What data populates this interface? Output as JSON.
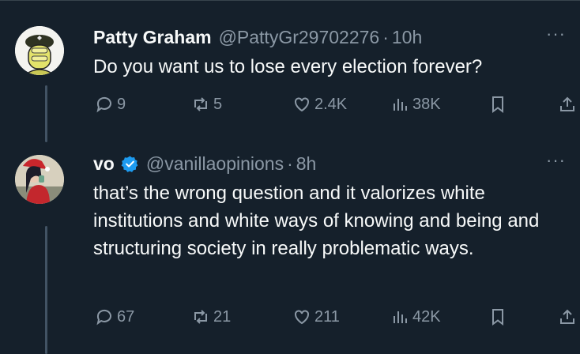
{
  "tweets": [
    {
      "name": "Patty Graham",
      "handle": "@PattyGr29702276",
      "separator": "·",
      "time": "10h",
      "more": "···",
      "text": "Do you want us to lose every election forever?",
      "verified": false,
      "stats": {
        "replies": "9",
        "retweets": "5",
        "likes": "2.4K",
        "views": "38K"
      }
    },
    {
      "name": "vo",
      "handle": "@vanillaopinions",
      "separator": "·",
      "time": "8h",
      "more": "···",
      "text": "that’s the wrong question and it valorizes white institutions and white ways of knowing and being and structuring society in really problematic ways.",
      "verified": true,
      "stats": {
        "replies": "67",
        "retweets": "21",
        "likes": "211",
        "views": "42K"
      }
    }
  ],
  "colors": {
    "background": "#15202b",
    "text": "#f7f9f9",
    "muted": "#8b98a5",
    "verified": "#1d9bf0",
    "thread_line": "#425364"
  },
  "icons": [
    "reply-icon",
    "retweet-icon",
    "like-icon",
    "views-icon",
    "bookmark-icon",
    "share-icon",
    "more-icon",
    "verified-badge-icon"
  ]
}
